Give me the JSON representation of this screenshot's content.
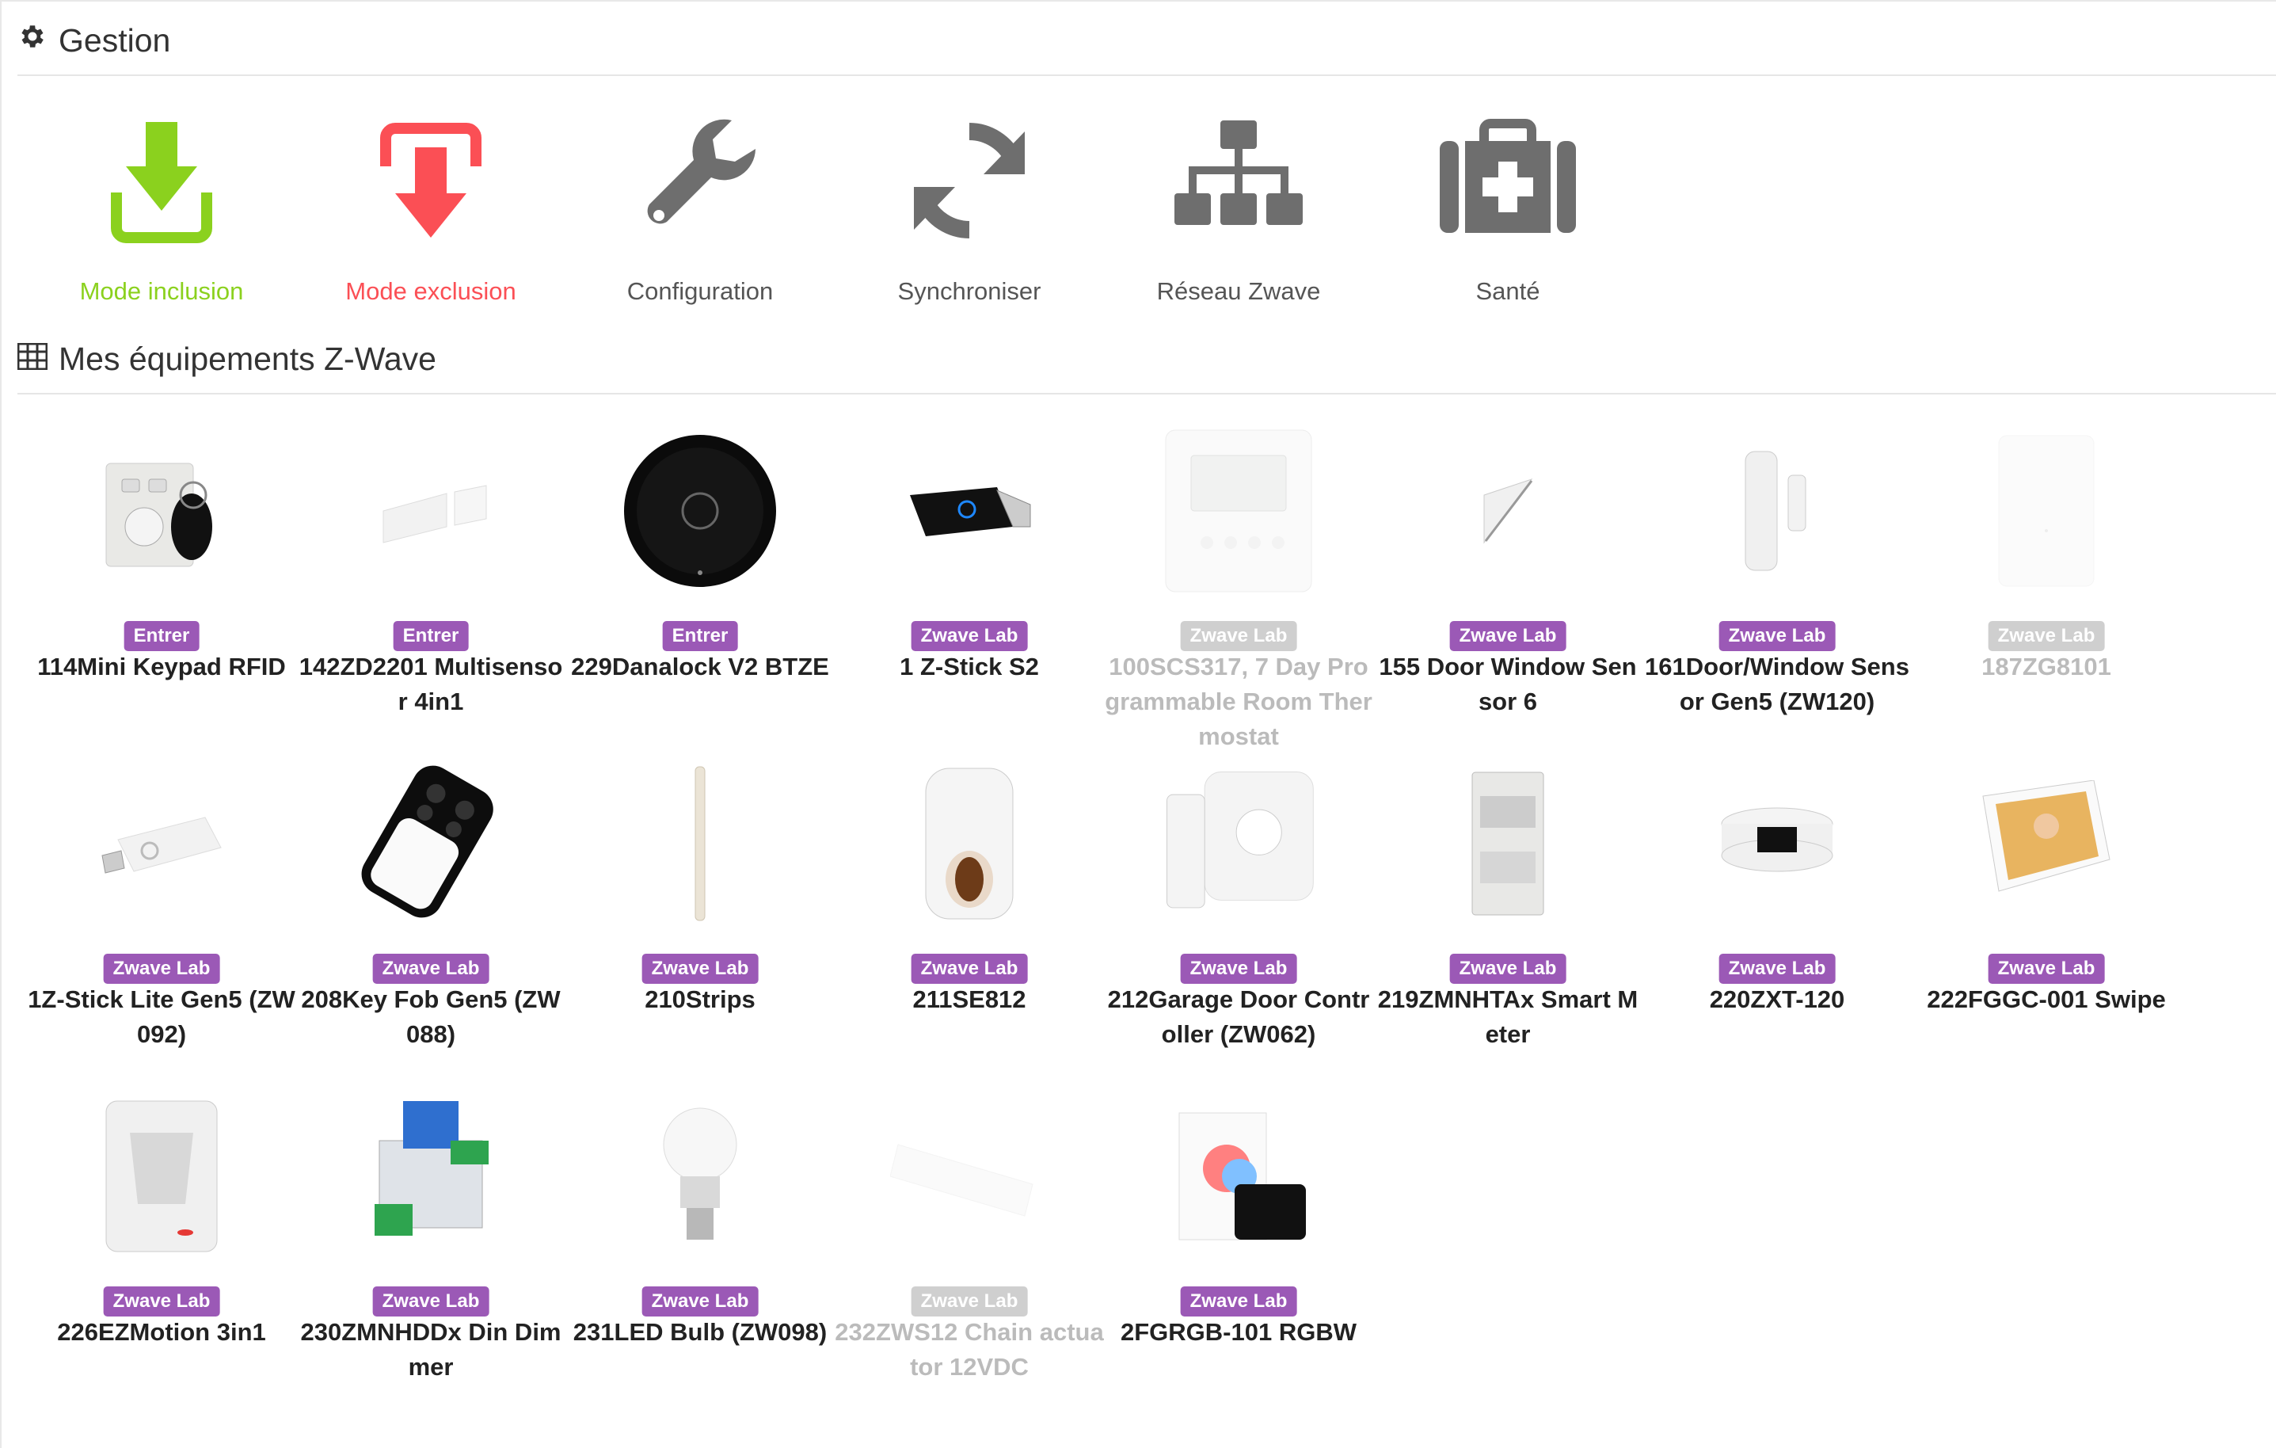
{
  "colors": {
    "inclusion": "#8bd11e",
    "exclusion": "#fb4f55",
    "neutral_icon": "#6e6e6e",
    "badge": "#9b59b6",
    "badge_disabled": "#cfcfcf"
  },
  "gestion": {
    "title": "Gestion",
    "icon": "gear-icon",
    "actions": [
      {
        "label": "Mode inclusion",
        "icon": "download-tray-icon"
      },
      {
        "label": "Mode exclusion",
        "icon": "upload-tray-icon"
      },
      {
        "label": "Configuration",
        "icon": "wrench-icon"
      },
      {
        "label": "Synchroniser",
        "icon": "refresh-icon"
      },
      {
        "label": "Réseau Zwave",
        "icon": "sitemap-icon"
      },
      {
        "label": "Santé",
        "icon": "medkit-icon"
      }
    ]
  },
  "equipements": {
    "title": "Mes équipements Z-Wave",
    "icon": "table-icon",
    "devices": [
      {
        "badge": "Entrer",
        "name": "114Mini Keypad RFID",
        "enabled": true,
        "image": "keypad-image"
      },
      {
        "badge": "Entrer",
        "name": "142ZD2201 Multisensor 4in1",
        "enabled": true,
        "image": "door-sensor-image"
      },
      {
        "badge": "Entrer",
        "name": "229Danalock V2 BTZE",
        "enabled": true,
        "image": "lock-image"
      },
      {
        "badge": "Zwave Lab",
        "name": "1 Z-Stick S2",
        "enabled": true,
        "image": "usb-stick-image"
      },
      {
        "badge": "Zwave Lab",
        "name": "100SCS317, 7 Day Programmable Room Thermostat",
        "enabled": false,
        "image": "thermostat-image"
      },
      {
        "badge": "Zwave Lab",
        "name": "155 Door Window Sensor 6",
        "enabled": true,
        "image": "triangle-sensor-image"
      },
      {
        "badge": "Zwave Lab",
        "name": "161Door/Window Sensor Gen5 (ZW120)",
        "enabled": true,
        "image": "door-window-sensor-image"
      },
      {
        "badge": "Zwave Lab",
        "name": "187ZG8101",
        "enabled": false,
        "image": "sensor-box-image"
      },
      {
        "badge": "Zwave Lab",
        "name": "1Z-Stick Lite Gen5 (ZW092)",
        "enabled": true,
        "image": "usb-stick-white-image"
      },
      {
        "badge": "Zwave Lab",
        "name": "208Key Fob Gen5 (ZW088)",
        "enabled": true,
        "image": "key-fob-image"
      },
      {
        "badge": "Zwave Lab",
        "name": "210Strips",
        "enabled": true,
        "image": "strip-image"
      },
      {
        "badge": "Zwave Lab",
        "name": "211SE812",
        "enabled": true,
        "image": "siren-image"
      },
      {
        "badge": "Zwave Lab",
        "name": "212Garage Door Controller (ZW062)",
        "enabled": true,
        "image": "garage-controller-image"
      },
      {
        "badge": "Zwave Lab",
        "name": "219ZMNHTAx Smart Meter",
        "enabled": true,
        "image": "smart-meter-image"
      },
      {
        "badge": "Zwave Lab",
        "name": "220ZXT-120",
        "enabled": true,
        "image": "ir-extender-image"
      },
      {
        "badge": "Zwave Lab",
        "name": "222FGGC-001 Swipe",
        "enabled": true,
        "image": "swipe-tablet-image"
      },
      {
        "badge": "Zwave Lab",
        "name": "226EZMotion 3in1",
        "enabled": true,
        "image": "motion-sensor-image"
      },
      {
        "badge": "Zwave Lab",
        "name": "230ZMNHDDx Din Dimmer",
        "enabled": true,
        "image": "din-dimmer-image"
      },
      {
        "badge": "Zwave Lab",
        "name": "231LED Bulb (ZW098)",
        "enabled": true,
        "image": "led-bulb-image"
      },
      {
        "badge": "Zwave Lab",
        "name": "232ZWS12 Chain actuator 12VDC",
        "enabled": false,
        "image": "chain-actuator-image"
      },
      {
        "badge": "Zwave Lab",
        "name": "2FGRGB-101 RGBW",
        "enabled": true,
        "image": "rgbw-controller-image"
      }
    ]
  }
}
